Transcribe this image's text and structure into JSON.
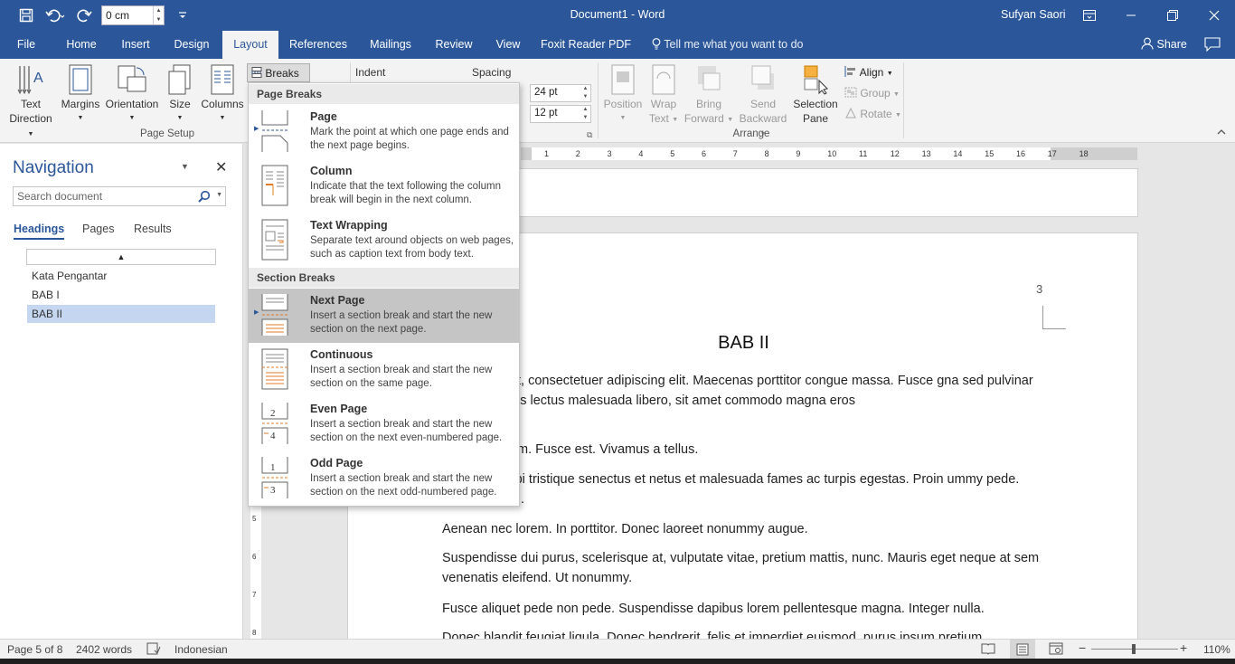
{
  "window": {
    "doc_title": "Document1 - Word",
    "user_name": "Sufyan Saori",
    "zoom_field_value": "0 cm"
  },
  "tabs": [
    {
      "label": "File"
    },
    {
      "label": "Home"
    },
    {
      "label": "Insert"
    },
    {
      "label": "Design"
    },
    {
      "label": "Layout"
    },
    {
      "label": "References"
    },
    {
      "label": "Mailings"
    },
    {
      "label": "Review"
    },
    {
      "label": "View"
    },
    {
      "label": "Foxit Reader PDF"
    }
  ],
  "tell_me": "Tell me what you want to do",
  "share_label": "Share",
  "ribbon": {
    "text_direction": [
      "Text",
      "Direction"
    ],
    "margins": "Margins",
    "orientation": "Orientation",
    "size": "Size",
    "columns": "Columns",
    "breaks": "Breaks",
    "page_setup_label": "Page Setup",
    "indent_label": "Indent",
    "spacing_label": "Spacing",
    "spacing_before": "24 pt",
    "spacing_after": "12 pt",
    "position": "Position",
    "wrap_text": [
      "Wrap",
      "Text"
    ],
    "bring_forward": [
      "Bring",
      "Forward"
    ],
    "send_backward": [
      "Send",
      "Backward"
    ],
    "selection_pane": [
      "Selection",
      "Pane"
    ],
    "align": "Align",
    "group": "Group",
    "rotate": "Rotate",
    "arrange_label": "Arrange"
  },
  "navigation": {
    "title": "Navigation",
    "search_placeholder": "Search document",
    "tabs": [
      "Headings",
      "Pages",
      "Results"
    ],
    "headings": [
      "Kata Pengantar",
      "BAB I",
      "BAB II"
    ]
  },
  "breaks_menu": {
    "page_breaks_label": "Page Breaks",
    "section_breaks_label": "Section Breaks",
    "items": [
      {
        "title": "Page",
        "desc": "Mark the point at which one page ends and the next page begins."
      },
      {
        "title": "Column",
        "desc": "Indicate that the text following the column break will begin in the next column."
      },
      {
        "title": "Text Wrapping",
        "desc": "Separate text around objects on web pages, such as caption text from body text."
      },
      {
        "title": "Next Page",
        "desc": "Insert a section break and start the new section on the next page."
      },
      {
        "title": "Continuous",
        "desc": "Insert a section break and start the new section on the same page."
      },
      {
        "title": "Even Page",
        "desc": "Insert a section break and start the new section on the next even-numbered page."
      },
      {
        "title": "Odd Page",
        "desc": "Insert a section break and start the new section on the next odd-numbered page."
      }
    ]
  },
  "ruler": {
    "ticks": [
      "1",
      "2",
      "3",
      "4",
      "5",
      "6",
      "7",
      "8",
      "9",
      "10",
      "11",
      "12",
      "13",
      "14",
      "15",
      "16",
      "17",
      "18"
    ],
    "vticks": [
      "5",
      "6",
      "7",
      "8"
    ]
  },
  "document": {
    "page_number": "3",
    "heading": "BAB II",
    "paragraphs": [
      "dolor sit amet, consectetuer adipiscing elit. Maecenas porttitor congue massa. Fusce gna sed pulvinar ultricies, purus lectus malesuada libero, sit amet commodo magna eros",
      "imperdiet enim. Fusce est. Vivamus a tellus.",
      "habitant morbi tristique senectus et netus et malesuada fames ac turpis egestas. Proin ummy pede. Mauris et orci.",
      "Aenean nec lorem. In porttitor. Donec laoreet nonummy augue.",
      "Suspendisse dui purus, scelerisque at, vulputate vitae, pretium mattis, nunc. Mauris eget neque at sem venenatis eleifend. Ut nonummy.",
      "Fusce aliquet pede non pede. Suspendisse dapibus lorem pellentesque magna. Integer nulla.",
      "Donec blandit feugiat ligula. Donec hendrerit, felis et imperdiet euismod, purus ipsum pretium"
    ]
  },
  "status": {
    "page": "Page 5 of 8",
    "words": "2402 words",
    "language": "Indonesian",
    "zoom": "110%"
  },
  "colors": {
    "accent": "#2b579a",
    "ribbon_bg": "#f3f3f3",
    "hover": "#c5c5c5"
  }
}
